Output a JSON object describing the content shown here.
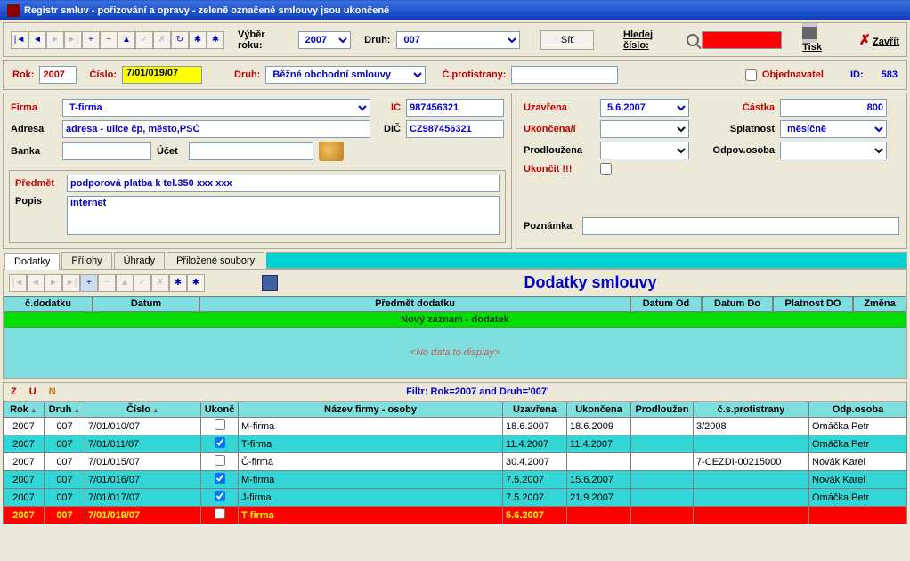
{
  "title": "Registr smluv - pořizování a opravy - zeleně označené smlouvy jsou ukončené",
  "toolbar": {
    "vyber_roku": "Výběr roku:",
    "rok": "2007",
    "druh_lbl": "Druh:",
    "druh": "007",
    "sit": "Síť",
    "hledej": "Hledej číslo:",
    "tisk": "Tisk",
    "zavrit": "Zavřít"
  },
  "header": {
    "rok_lbl": "Rok:",
    "rok": "2007",
    "cislo_lbl": "Číslo:",
    "cislo": "7/01/019/07",
    "druh_lbl": "Druh:",
    "druh": "Běžné obchodní smlouvy",
    "cproti_lbl": "Č.protistrany:",
    "cproti": "",
    "objednavatel": "Objednavatel",
    "id_lbl": "ID:",
    "id": "583"
  },
  "left": {
    "firma_lbl": "Firma",
    "firma": "T-firma",
    "ic_lbl": "IČ",
    "ic": "987456321",
    "adresa_lbl": "Adresa",
    "adresa": "adresa - ulice čp, město,PSČ",
    "dic_lbl": "DIČ",
    "dic": "CZ987456321",
    "banka_lbl": "Banka",
    "banka": "",
    "ucet_lbl": "Účet",
    "ucet": "",
    "predmet_lbl": "Předmět",
    "predmet": "podporová platba k tel.350 xxx xxx",
    "popis_lbl": "Popis",
    "popis": "internet"
  },
  "right": {
    "uzavrena_lbl": "Uzavřena",
    "uzavrena": "5.6.2007",
    "ukoncena_lbl": "Ukončena/í",
    "ukoncena": "",
    "prodlouzena_lbl": "Prodloužena",
    "prodlouzena": "",
    "ukoncit_lbl": "Ukončit !!!",
    "castka_lbl": "Částka",
    "castka": "800",
    "splatnost_lbl": "Splatnost",
    "splatnost": "měsíčně",
    "odpov_lbl": "Odpov.osoba",
    "odpov": "",
    "poznamka_lbl": "Poznámka",
    "poznamka": ""
  },
  "tabs": [
    "Dodatky",
    "Přílohy",
    "Úhrady",
    "Přiložené soubory"
  ],
  "dodatky": {
    "title": "Dodatky smlouvy",
    "cols": [
      "č.dodatku",
      "Datum",
      "Předmět dodatku",
      "Datum Od",
      "Datum Do",
      "Platnost DO",
      "Změna"
    ],
    "newrec": "Nový záznam - dodatek",
    "nodata": "<No data to display>"
  },
  "filter": {
    "zun": [
      "Z",
      "U",
      "N"
    ],
    "text": "Filtr: Rok=2007 and Druh='007'"
  },
  "grid": {
    "cols": [
      "Rok",
      "Druh",
      "Číslo",
      "Ukonč",
      "Název firmy - osoby",
      "Uzavřena",
      "Ukončena",
      "Prodloužen",
      "č.s.protistrany",
      "Odp.osoba"
    ],
    "rows": [
      {
        "cls": "rw-white",
        "rok": "2007",
        "druh": "007",
        "cislo": "7/01/010/07",
        "uk": false,
        "firma": "M-firma",
        "uz": "18.6.2007",
        "ukn": "18.6.2009",
        "pr": "",
        "cs": "3/2008",
        "od": "Omáčka Petr"
      },
      {
        "cls": "rw-cyan",
        "rok": "2007",
        "druh": "007",
        "cislo": "7/01/011/07",
        "uk": true,
        "firma": "T-firma",
        "uz": "11.4.2007",
        "ukn": "11.4.2007",
        "pr": "",
        "cs": "",
        "od": "Omáčka Petr"
      },
      {
        "cls": "rw-white",
        "rok": "2007",
        "druh": "007",
        "cislo": "7/01/015/07",
        "uk": false,
        "firma": "Č-firma",
        "uz": "30.4.2007",
        "ukn": "",
        "pr": "",
        "cs": "7-CEZDI-00215000",
        "od": "Novák Karel"
      },
      {
        "cls": "rw-cyan",
        "rok": "2007",
        "druh": "007",
        "cislo": "7/01/016/07",
        "uk": true,
        "firma": "M-firma",
        "uz": "7.5.2007",
        "ukn": "15.6.2007",
        "pr": "",
        "cs": "",
        "od": "Novák Karel"
      },
      {
        "cls": "rw-cyan",
        "rok": "2007",
        "druh": "007",
        "cislo": "7/01/017/07",
        "uk": true,
        "firma": "J-firma",
        "uz": "7.5.2007",
        "ukn": "21.9.2007",
        "pr": "",
        "cs": "",
        "od": "Omáčka Petr"
      },
      {
        "cls": "rw-red",
        "rok": "2007",
        "druh": "007",
        "cislo": "7/01/019/07",
        "uk": false,
        "firma": "T-firma",
        "uz": "5.6.2007",
        "ukn": "",
        "pr": "",
        "cs": "",
        "od": ""
      }
    ]
  }
}
